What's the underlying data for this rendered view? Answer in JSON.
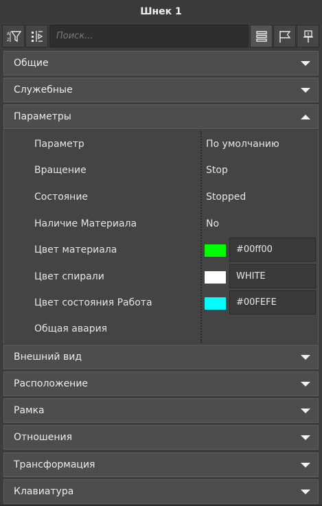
{
  "window": {
    "title": "Шнек 1"
  },
  "toolbar": {
    "search_placeholder": "Поиск..."
  },
  "sections": {
    "general": "Общие",
    "service": "Служебные",
    "parameters": "Параметры",
    "appearance": "Внешний вид",
    "position": "Расположение",
    "frame": "Рамка",
    "relations": "Отношения",
    "transform": "Трансформация",
    "keyboard": "Клавиатура"
  },
  "params": {
    "header": {
      "label": "Параметр",
      "value": "По умолчанию"
    },
    "rows": [
      {
        "label": "Вращение",
        "value": "Stop"
      },
      {
        "label": "Состояние",
        "value": "Stopped"
      },
      {
        "label": "Наличие Материала",
        "value": "No"
      },
      {
        "label": "Цвет материала",
        "value": "#00ff00",
        "color": "#00ff00"
      },
      {
        "label": "Цвет спирали",
        "value": "WHITE",
        "color": "#ffffff"
      },
      {
        "label": "Цвет состояния Работа",
        "value": "#00FEFE",
        "color": "#00fefe"
      },
      {
        "label": "Общая авария",
        "value": ""
      }
    ]
  },
  "icons": {
    "filter": "filter-sort-icon",
    "collapse": "collapse-tree-icon",
    "list": "list-view-icon",
    "flag": "flag-icon",
    "pin": "pin-icon"
  },
  "colors": {
    "background": "#3c3c3c",
    "section": "#4d4d4d",
    "panel": "#444444"
  }
}
